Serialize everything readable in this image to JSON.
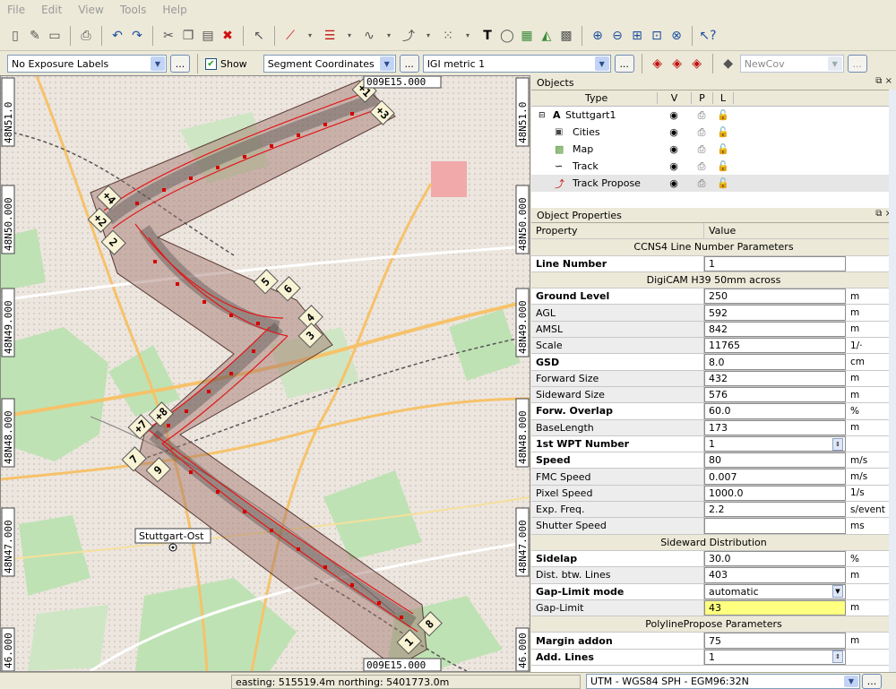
{
  "menu": [
    "File",
    "Edit",
    "View",
    "Tools",
    "Help"
  ],
  "options": {
    "exposure_labels": "No Exposure Labels",
    "show_label": "Show",
    "segment_coordinates": "Segment Coordinates",
    "metric": "IGI metric 1",
    "newcov": "NewCov",
    "ellipsis": "..."
  },
  "map": {
    "top_lon_label": "009E15.000",
    "bottom_lon_label": "009E15.000",
    "left_lat_labels": [
      "48N51.0",
      "48N50.000",
      "48N49.000",
      "48N48.000",
      "48N47.000",
      "46.000"
    ],
    "right_lat_labels": [
      "48N51.0",
      "48N50.000",
      "48N49.000",
      "48N48.000",
      "48N47.000",
      "46.000"
    ],
    "city_label": "Stuttgart-Ost",
    "line_labels": [
      "1",
      "2",
      "3",
      "4",
      "5",
      "6",
      "7",
      "8",
      "9",
      "+1",
      "+2",
      "+3",
      "+4",
      "+5",
      "+6",
      "+7",
      "+8",
      "+9"
    ],
    "colors": {
      "corridor": "#a0706a",
      "track": "#3b3b3b",
      "red": "#e01818",
      "points": "#d40000"
    }
  },
  "objects": {
    "title": "Objects",
    "headers": {
      "type": "Type",
      "v": "V",
      "p": "P",
      "l": "L"
    },
    "items": [
      {
        "name": "Stuttgart1",
        "prefix": "A"
      },
      {
        "name": "Cities"
      },
      {
        "name": "Map"
      },
      {
        "name": "Track"
      },
      {
        "name": "Track Propose"
      }
    ]
  },
  "properties": {
    "title": "Object Properties",
    "headers": {
      "property": "Property",
      "value": "Value"
    },
    "rows": [
      {
        "section": "CCNS4 Line Number Parameters"
      },
      {
        "key": "Line Number",
        "value": "1",
        "unit": "",
        "bold": true
      },
      {
        "section": "DigiCAM H39 50mm across"
      },
      {
        "key": "Ground Level",
        "value": "250",
        "unit": "m",
        "bold": true
      },
      {
        "key": "AGL",
        "value": "592",
        "unit": "m"
      },
      {
        "key": "AMSL",
        "value": "842",
        "unit": "m"
      },
      {
        "key": "Scale",
        "value": "11765",
        "unit": "1/·"
      },
      {
        "key": "GSD",
        "value": "8.0",
        "unit": "cm",
        "bold": true
      },
      {
        "key": "Forward Size",
        "value": "432",
        "unit": "m"
      },
      {
        "key": "Sideward Size",
        "value": "576",
        "unit": "m"
      },
      {
        "key": "Forw. Overlap",
        "value": "60.0",
        "unit": "%",
        "bold": true
      },
      {
        "key": "BaseLength",
        "value": "173",
        "unit": "m"
      },
      {
        "key": "1st WPT Number",
        "value": "1",
        "unit": "",
        "bold": true,
        "spin": true
      },
      {
        "key": "Speed",
        "value": "80",
        "unit": "m/s",
        "bold": true
      },
      {
        "key": "FMC Speed",
        "value": "0.007",
        "unit": "m/s"
      },
      {
        "key": "Pixel Speed",
        "value": "1000.0",
        "unit": "1/s"
      },
      {
        "key": "Exp. Freq.",
        "value": "2.2",
        "unit": "s/event"
      },
      {
        "key": "Shutter Speed",
        "value": "",
        "unit": "ms"
      },
      {
        "section": "Sideward Distribution"
      },
      {
        "key": "Sidelap",
        "value": "30.0",
        "unit": "%",
        "bold": true
      },
      {
        "key": "Dist. btw. Lines",
        "value": "403",
        "unit": "m"
      },
      {
        "key": "Gap-Limit mode",
        "value": "automatic",
        "unit": "",
        "bold": true,
        "combo": true
      },
      {
        "key": "Gap-Limit",
        "value": "43",
        "unit": "m",
        "highlight": "#ffff80"
      },
      {
        "section": "PolylinePropose Parameters"
      },
      {
        "key": "Margin addon",
        "value": "75",
        "unit": "m",
        "bold": true
      },
      {
        "key": "Add. Lines",
        "value": "1",
        "unit": "",
        "bold": true,
        "spin": true
      }
    ]
  },
  "status": {
    "coords": "easting: 515519.4m northing: 5401773.0m",
    "projection": "UTM - WGS84 SPH - EGM96:32N"
  }
}
